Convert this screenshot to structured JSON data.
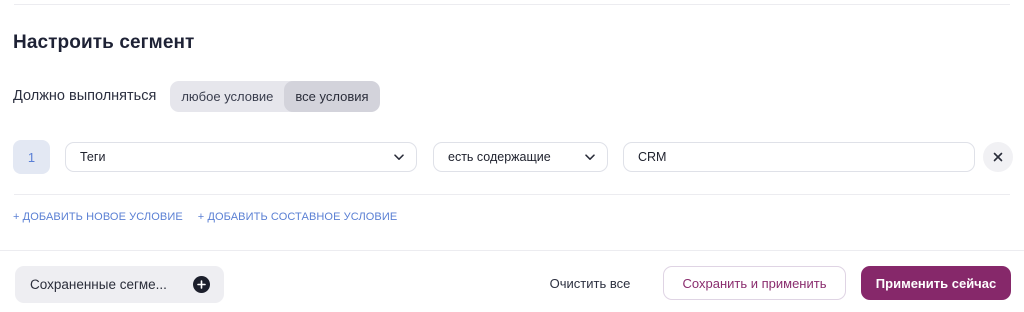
{
  "segment": {
    "title": "Настроить сегмент",
    "condition_label": "Должно выполняться",
    "condition_options": [
      "любое условие",
      "все условия"
    ],
    "selected_condition": "все условия"
  },
  "rules": [
    {
      "number": "1",
      "field": "Теги",
      "operator": "есть содержащие",
      "value": "CRM"
    }
  ],
  "actions": {
    "add_condition": "+ ДОБАВИТЬ НОВОЕ УСЛОВИЕ",
    "add_compound_condition": "+ ДОБАВИТЬ СОСТАВНОЕ УСЛОВИЕ"
  },
  "footer": {
    "saved_segments": "Сохраненные сегме...",
    "clear_all": "Очистить все",
    "save_and_apply": "Сохранить и применить",
    "apply_now": "Применить сейчас"
  },
  "icons": {
    "dropdown": "chevron-down-icon",
    "remove": "close-icon",
    "add": "plus-circle-icon"
  },
  "colors": {
    "accent": "#86286a",
    "link": "#5b80d4",
    "rule_number": "#5a7fd6"
  }
}
